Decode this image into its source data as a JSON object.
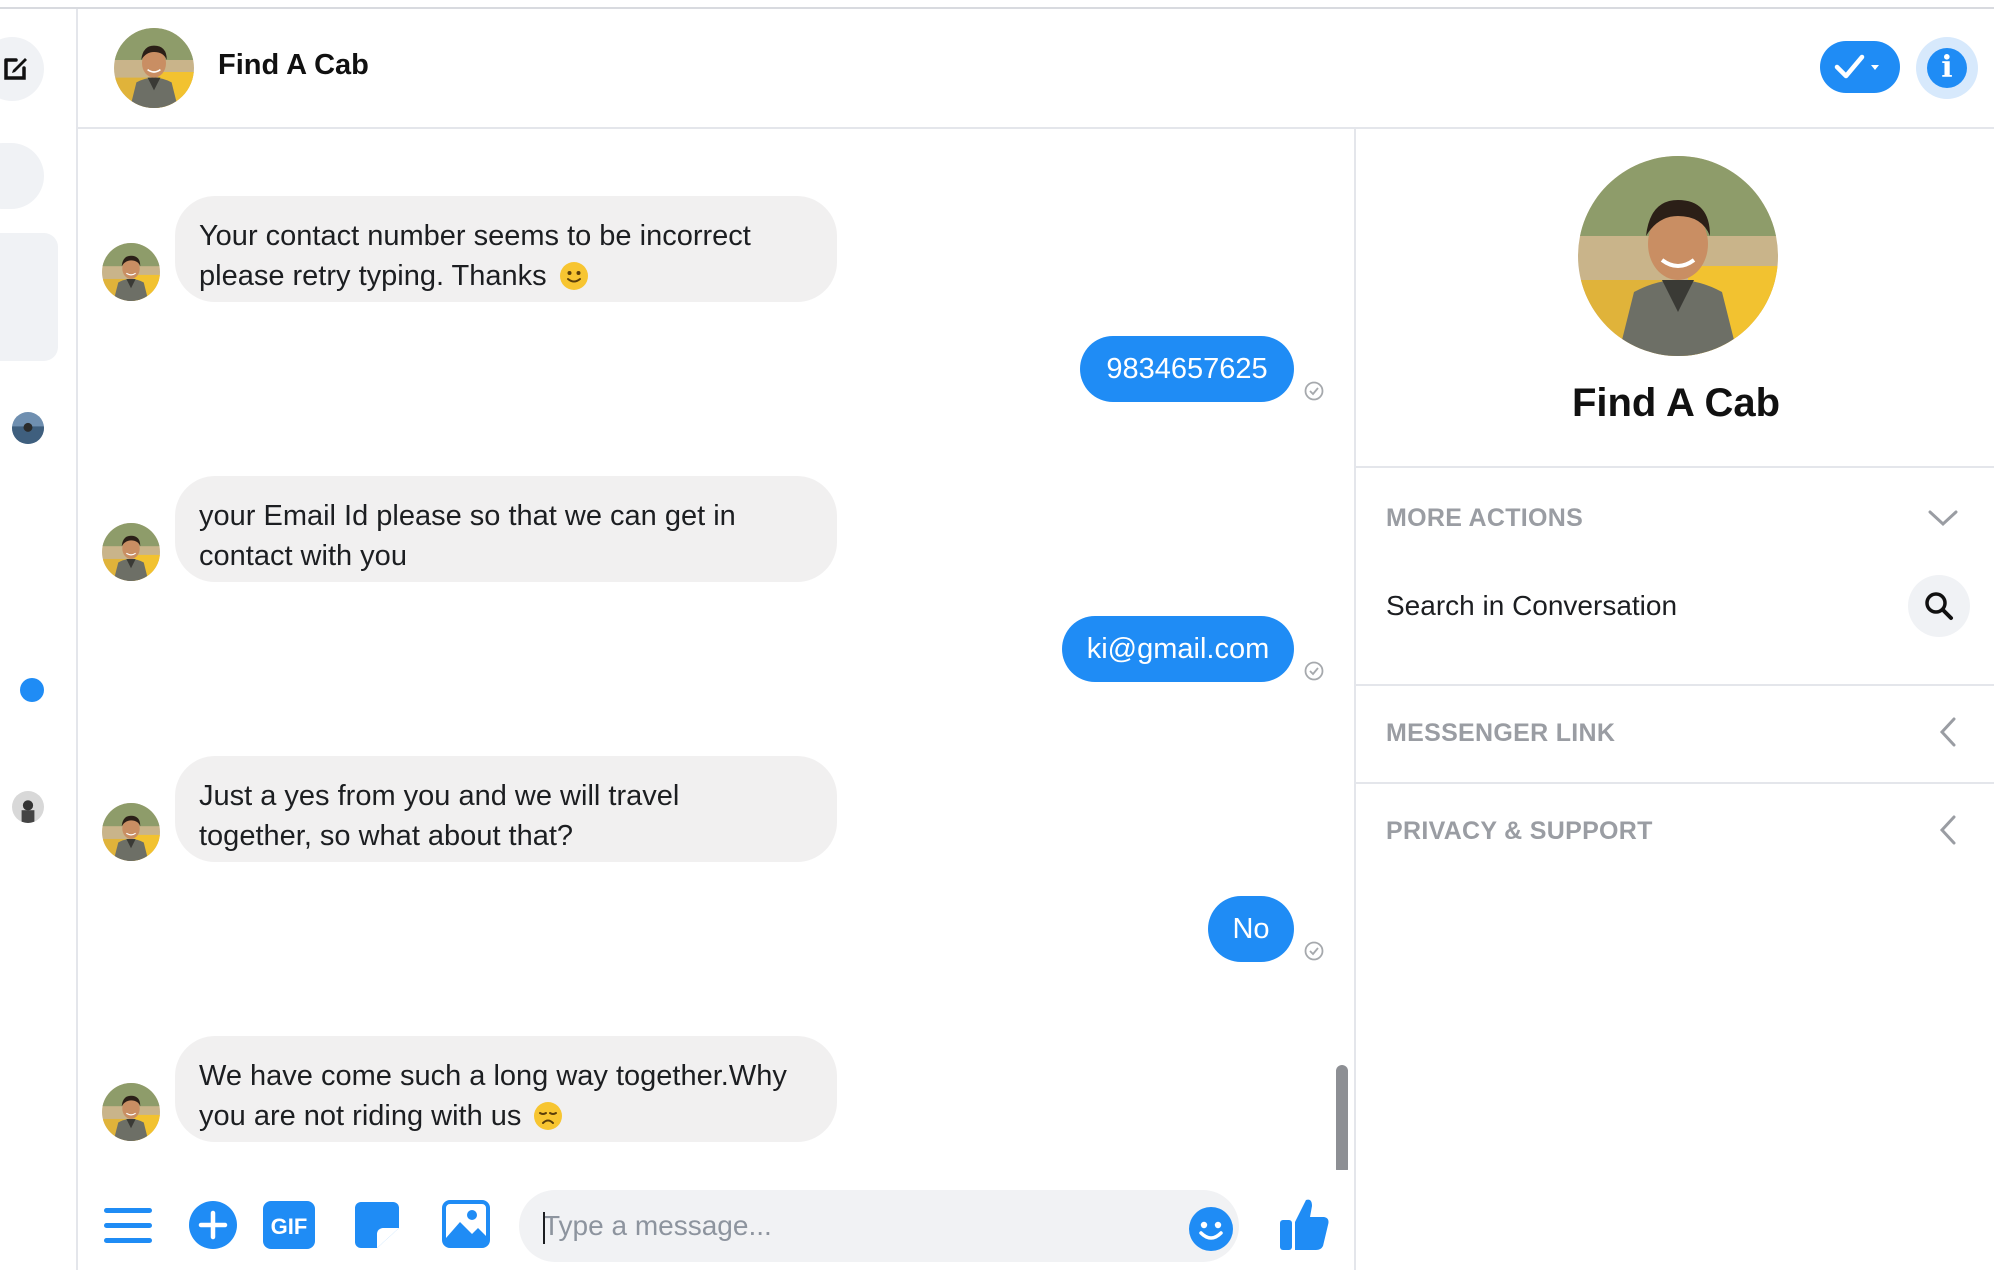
{
  "header": {
    "title": "Find A Cab"
  },
  "panel": {
    "name": "Find A Cab",
    "sections": {
      "more_actions": "MORE ACTIONS",
      "search_label": "Search in Conversation",
      "messenger_link": "MESSENGER LINK",
      "privacy_support": "PRIVACY & SUPPORT"
    }
  },
  "messages": {
    "m1": {
      "from": "bot",
      "line1": "Your contact number seems to be incorrect",
      "line2": "please retry typing. Thanks",
      "emoji": "slightly-smiling-face"
    },
    "m2": {
      "from": "user",
      "text": "9834657625"
    },
    "m3": {
      "from": "bot",
      "line1": "your Email Id please so that we can get in",
      "line2": "contact with you"
    },
    "m4": {
      "from": "user",
      "text": "ki@gmail.com"
    },
    "m5": {
      "from": "bot",
      "line1": "Just a yes from you and we will travel",
      "line2": "together, so what about that?"
    },
    "m6": {
      "from": "user",
      "text": "No"
    },
    "m7": {
      "from": "bot",
      "line1": "We have come such a long way together.Why",
      "line2": "you are not riding with us",
      "emoji": "disappointed-face"
    }
  },
  "composer": {
    "placeholder": "Type a message...",
    "icons": [
      "menu-icon",
      "plus-icon",
      "gif-icon",
      "sticker-icon",
      "photo-icon",
      "emoji-icon",
      "thumbs-up-icon"
    ]
  },
  "colors": {
    "accent": "#1f8cf5",
    "incoming_bubble": "#f1f0f0",
    "section_title": "#9a9da3"
  }
}
